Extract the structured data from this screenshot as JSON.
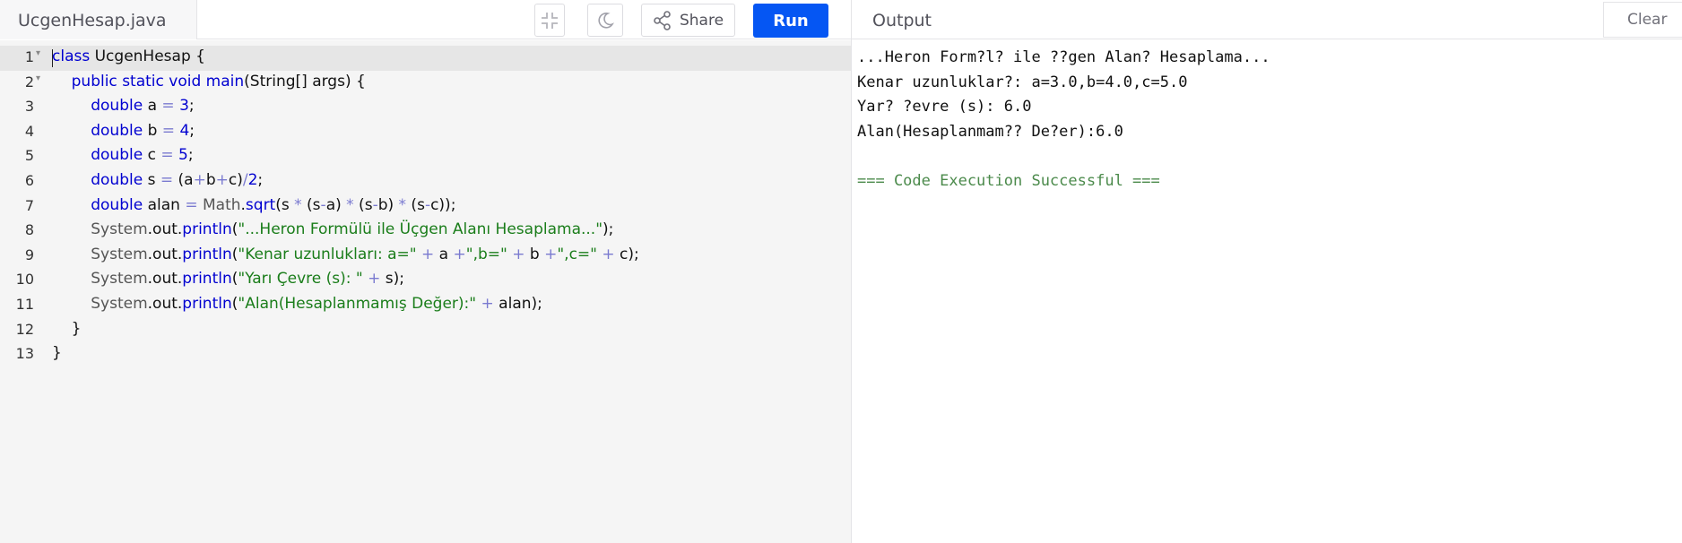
{
  "header": {
    "file_name": "UcgenHesap.java",
    "share_label": "Share",
    "run_label": "Run",
    "output_label": "Output",
    "clear_label": "Clear",
    "accent_color": "#0556f3"
  },
  "editor": {
    "active_line": 1,
    "lines": [
      {
        "num": "1",
        "fold": true
      },
      {
        "num": "2",
        "fold": true
      },
      {
        "num": "3",
        "fold": false
      },
      {
        "num": "4",
        "fold": false
      },
      {
        "num": "5",
        "fold": false
      },
      {
        "num": "6",
        "fold": false
      },
      {
        "num": "7",
        "fold": false
      },
      {
        "num": "8",
        "fold": false
      },
      {
        "num": "9",
        "fold": false
      },
      {
        "num": "10",
        "fold": false
      },
      {
        "num": "11",
        "fold": false
      },
      {
        "num": "12",
        "fold": false
      },
      {
        "num": "13",
        "fold": false
      }
    ],
    "code": {
      "l1": {
        "kw": "class",
        "rest": " UcgenHesap {"
      },
      "l2": {
        "indent": "    ",
        "kw1": "public",
        "kw2": "static",
        "kw3": "void",
        "name": "main",
        "rest": "(String[] args) {"
      },
      "l3": {
        "indent": "        ",
        "kw": "double",
        "var": " a ",
        "eq": "=",
        "sp": " ",
        "num": "3",
        "end": ";"
      },
      "l4": {
        "indent": "        ",
        "kw": "double",
        "var": " b ",
        "eq": "=",
        "sp": " ",
        "num": "4",
        "end": ";"
      },
      "l5": {
        "indent": "        ",
        "kw": "double",
        "var": " c ",
        "eq": "=",
        "sp": " ",
        "num": "5",
        "end": ";"
      },
      "l6": {
        "indent": "        ",
        "kw": "double",
        "a": " s ",
        "eq": "=",
        "b": " (a",
        "p1": "+",
        "c": "b",
        "p2": "+",
        "d": "c)",
        "div": "/",
        "num": "2",
        "end": ";"
      },
      "l7": {
        "indent": "        ",
        "kw": "double",
        "a": " alan ",
        "eq": "=",
        "sp": " ",
        "cls": "Math",
        "dot": ".",
        "fn": "sqrt",
        "b": "(s ",
        "m1": "*",
        "c": " (s",
        "s1": "-",
        "d": "a) ",
        "m2": "*",
        "e": " (s",
        "s2": "-",
        "f": "b) ",
        "m3": "*",
        "g": " (s",
        "s3": "-",
        "h": "c));"
      },
      "l8": {
        "indent": "        ",
        "cls": "System",
        "mid": ".out.",
        "fn": "println",
        "open": "(",
        "str": "\"...Heron Formülü ile Üçgen Alanı Hesaplama...\"",
        "end": ");"
      },
      "l9": {
        "indent": "        ",
        "cls": "System",
        "mid": ".out.",
        "fn": "println",
        "open": "(",
        "s1": "\"Kenar uzunlukları: a=\"",
        "p1": " + ",
        "v1": "a ",
        "p2": "+",
        "s2": "\",b=\"",
        "p3": " + ",
        "v2": "b ",
        "p4": "+",
        "s3": "\",c=\"",
        "p5": " + ",
        "end": "c);"
      },
      "l10": {
        "indent": "        ",
        "cls": "System",
        "mid": ".out.",
        "fn": "println",
        "open": "(",
        "s1": "\"Yarı Çevre (s): \"",
        "p1": " + ",
        "end": "s);"
      },
      "l11": {
        "indent": "        ",
        "cls": "System",
        "mid": ".out.",
        "fn": "println",
        "open": "(",
        "s1": "\"Alan(Hesaplanmamış Değer):\"",
        "p1": " + ",
        "end": "alan);"
      },
      "l12": {
        "text": "    }"
      },
      "l13": {
        "text": "}"
      }
    }
  },
  "output": {
    "lines": [
      "...Heron Form?l? ile ??gen Alan? Hesaplama...",
      "Kenar uzunluklar?: a=3.0,b=4.0,c=5.0",
      "Yar? ?evre (s): 6.0",
      "Alan(Hesaplanmam?? De?er):6.0",
      "",
      "=== Code Execution Successful ==="
    ]
  }
}
